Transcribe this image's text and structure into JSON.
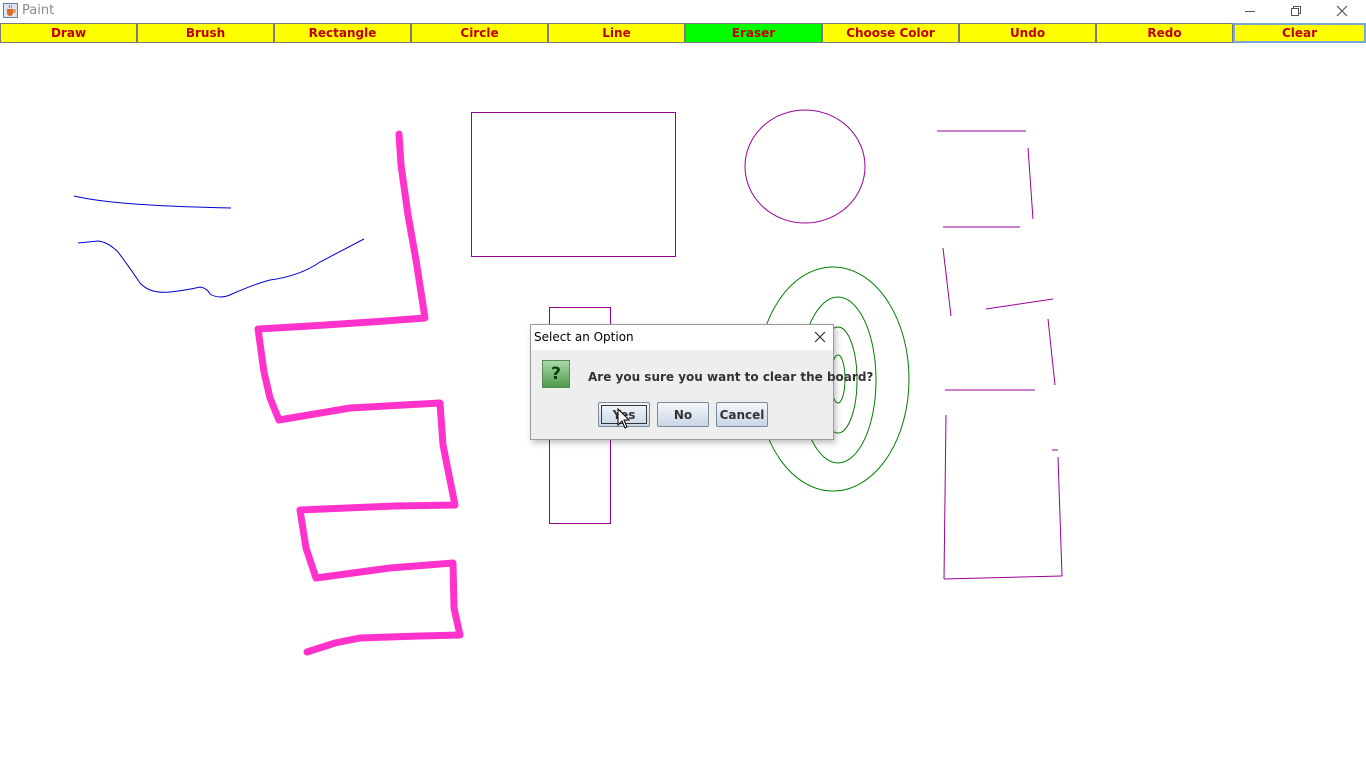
{
  "window": {
    "title": "Paint",
    "icon": "java-cup-icon",
    "controls": [
      "minimize-icon",
      "restore-icon",
      "close-icon"
    ]
  },
  "toolbar": {
    "buttons": [
      {
        "label": "Draw"
      },
      {
        "label": "Brush"
      },
      {
        "label": "Rectangle"
      },
      {
        "label": "Circle"
      },
      {
        "label": "Line"
      },
      {
        "label": "Eraser"
      },
      {
        "label": "Choose Color"
      },
      {
        "label": "Undo"
      },
      {
        "label": "Redo"
      },
      {
        "label": "Clear"
      }
    ],
    "active_tool": "Eraser",
    "focused_button": "Clear",
    "colors": {
      "button_bg": "#ffff00",
      "active_bg": "#00ff00",
      "label": "#c00000"
    }
  },
  "canvas": {
    "stroke_colors": {
      "freehand": "#0000cc",
      "brush": "#ff33cc",
      "shapes": "#990099",
      "ellipses": "#008000"
    }
  },
  "dialog": {
    "title": "Select an Option",
    "message": "Are you sure you want to clear the board?",
    "icon": "question-icon",
    "icon_glyph": "?",
    "buttons": {
      "yes": "Yes",
      "no": "No",
      "cancel": "Cancel"
    }
  }
}
